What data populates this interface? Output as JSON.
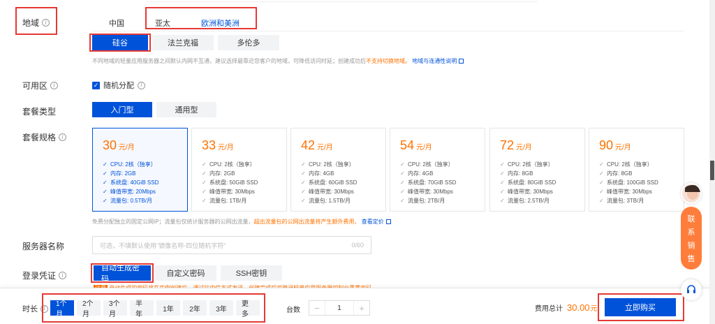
{
  "region": {
    "label": "地域",
    "country_tabs": [
      "中国",
      "亚太",
      "欧洲和美洲"
    ],
    "cities": [
      "硅谷",
      "法兰克福",
      "多伦多"
    ],
    "note_prefix": "不同地域的轻量应用服务器之间默认内网不互通，建议选择最靠近您客户的地域，可降低访问时延；创建成功后",
    "note_warn": "不支持切换地域。",
    "note_link": "地域与连通性说明"
  },
  "zone": {
    "label": "可用区",
    "option": "随机分配"
  },
  "package_type": {
    "label": "套餐类型",
    "options": [
      "入门型",
      "通用型"
    ]
  },
  "package_spec": {
    "label": "套餐规格",
    "unit": "元/月",
    "cards": [
      {
        "price": "30",
        "specs": [
          "CPU: 2核（独享）",
          "内存: 2GB",
          "系统盘: 40GiB SSD",
          "峰值带宽: 20Mbps",
          "流量包: 0.5TB/月"
        ]
      },
      {
        "price": "33",
        "specs": [
          "CPU: 2核（独享）",
          "内存: 2GB",
          "系统盘: 50GiB SSD",
          "峰值带宽: 30Mbps",
          "流量包: 1TB/月"
        ]
      },
      {
        "price": "42",
        "specs": [
          "CPU: 2核（独享）",
          "内存: 4GB",
          "系统盘: 60GiB SSD",
          "峰值带宽: 30Mbps",
          "流量包: 1.5TB/月"
        ]
      },
      {
        "price": "54",
        "specs": [
          "CPU: 2核（独享）",
          "内存: 4GB",
          "系统盘: 70GiB SSD",
          "峰值带宽: 30Mbps",
          "流量包: 2TB/月"
        ]
      },
      {
        "price": "72",
        "specs": [
          "CPU: 2核（独享）",
          "内存: 8GB",
          "系统盘: 80GiB SSD",
          "峰值带宽: 30Mbps",
          "流量包: 2.5TB/月"
        ]
      },
      {
        "price": "90",
        "specs": [
          "CPU: 2核（独享）",
          "内存: 8GB",
          "系统盘: 100GiB SSD",
          "峰值带宽: 30Mbps",
          "流量包: 3TB/月"
        ]
      }
    ],
    "note_prefix": "免费分配独立的固定公网IP；流量包仅统计服务器的公网出流量，",
    "note_warn": "超出流量包的公网出流量将产生额外费用，",
    "note_link": "查看定价"
  },
  "server_name": {
    "label": "服务器名称",
    "placeholder": "可选，不填默认使用\"镜像名称-四位随机字符\"",
    "counter": "0/60"
  },
  "login": {
    "label": "登录凭证",
    "options": [
      "自动生成密码",
      "自定义密码",
      "SSH密钥"
    ],
    "note_tag": "注意",
    "note_text": "自动生成的密码将在实例创建后，通过站内信方式发送，创建完成后可登录轻量应用服务器控制台重置密码"
  },
  "bottom": {
    "duration_label": "时长",
    "durations": [
      "1个月",
      "2个月",
      "3个月",
      "半年",
      "1年",
      "2年",
      "3年",
      "更多"
    ],
    "count_label": "台数",
    "count": "1",
    "minus": "−",
    "plus": "+",
    "total_label": "费用总计",
    "total": "30.00",
    "total_unit": "元",
    "buy": "立即购买"
  },
  "side_contact": {
    "chars": [
      "联",
      "系",
      "销",
      "售"
    ]
  },
  "colors": {
    "primary": "#0052d9",
    "warn": "#ff7200",
    "highlight": "#e53935"
  }
}
